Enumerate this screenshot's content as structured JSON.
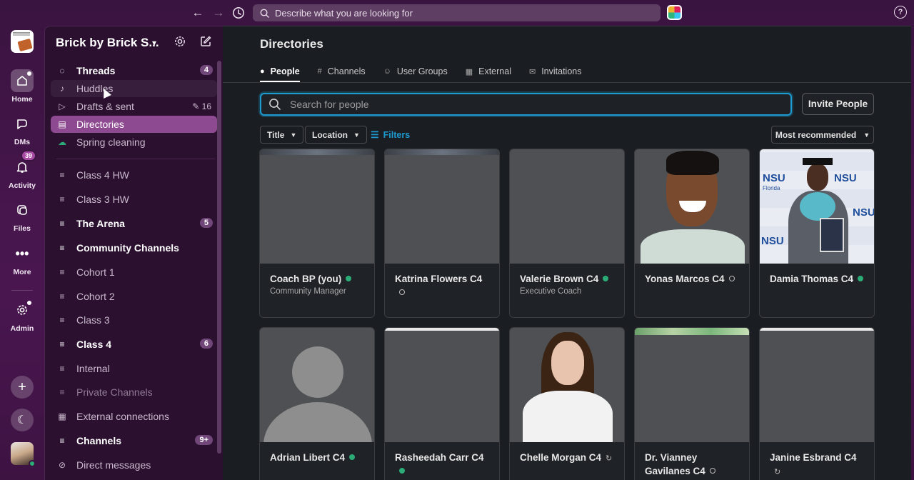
{
  "topbar": {
    "search_placeholder": "Describe what you are looking for"
  },
  "rail": {
    "home": "Home",
    "dms": "DMs",
    "activity": "Activity",
    "activity_badge": "39",
    "files": "Files",
    "more": "More",
    "admin": "Admin"
  },
  "sidebar": {
    "workspace_name": "Brick by Brick S...",
    "items": [
      {
        "label": "Threads",
        "badge": "4"
      },
      {
        "label": "Huddles"
      },
      {
        "label": "Drafts & sent",
        "count": "16"
      },
      {
        "label": "Directories"
      },
      {
        "label": "Spring cleaning"
      },
      {
        "label": "Class 4 HW"
      },
      {
        "label": "Class 3 HW"
      },
      {
        "label": "The Arena",
        "badge": "5"
      },
      {
        "label": "Community Channels"
      },
      {
        "label": "Cohort 1"
      },
      {
        "label": "Cohort 2"
      },
      {
        "label": "Class 3"
      },
      {
        "label": "Class 4",
        "badge": "6"
      },
      {
        "label": "Internal"
      },
      {
        "label": "Private Channels"
      },
      {
        "label": "External connections"
      },
      {
        "label": "Channels",
        "badge": "9+"
      },
      {
        "label": "Direct messages"
      }
    ]
  },
  "main": {
    "title": "Directories",
    "tabs": [
      {
        "label": "People"
      },
      {
        "label": "Channels"
      },
      {
        "label": "User Groups"
      },
      {
        "label": "External"
      },
      {
        "label": "Invitations"
      }
    ],
    "search_placeholder": "Search for people",
    "invite_button": "Invite People",
    "filter_title": "Title",
    "filter_location": "Location",
    "filters_link": "Filters",
    "sort": "Most recommended"
  },
  "people": [
    {
      "name": "Coach BP (you)",
      "title": "Community Manager",
      "status": "online"
    },
    {
      "name": "Katrina Flowers C4",
      "title": "",
      "status": "away"
    },
    {
      "name": "Valerie Brown C4",
      "title": "Executive Coach",
      "status": "online"
    },
    {
      "name": "Yonas Marcos C4",
      "title": "",
      "status": "away"
    },
    {
      "name": "Damia Thomas C4",
      "title": "",
      "status": "online"
    },
    {
      "name": "Adrian Libert C4",
      "title": "",
      "status": "online"
    },
    {
      "name": "Rasheedah Carr C4",
      "title": "",
      "status": "online"
    },
    {
      "name": "Chelle Morgan C4",
      "title": "",
      "status": "sync"
    },
    {
      "name": "Dr. Vianney Gavilanes C4",
      "title": "",
      "status": "away"
    },
    {
      "name": "Janine Esbrand C4",
      "title": "",
      "status": "sync"
    }
  ],
  "photo_text": {
    "nsu": "NSU",
    "florida": "Florida"
  }
}
